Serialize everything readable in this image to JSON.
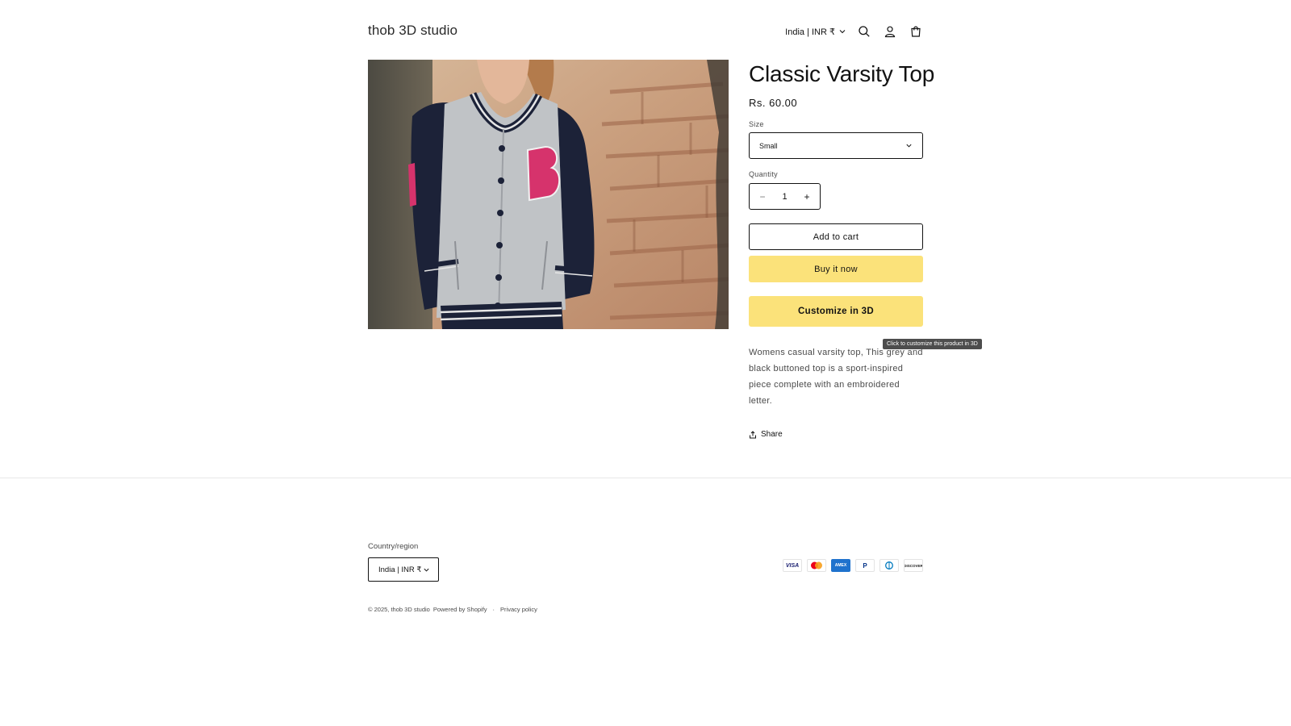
{
  "header": {
    "brand": "thob 3D studio",
    "localization": "India | INR ₹",
    "icons": [
      "search-icon",
      "account-icon",
      "cart-icon"
    ]
  },
  "product": {
    "image_alt": "Woman wearing grey varsity jacket with navy sleeves and pink B patch",
    "title": "Classic Varsity Top",
    "price": "Rs. 60.00",
    "size_label": "Size",
    "size_value": "Small",
    "quantity_label": "Quantity",
    "quantity_value": "1",
    "decrease_label": "−",
    "increase_label": "+",
    "add_to_cart": "Add to cart",
    "buy_now": "Buy it now",
    "customize": "Customize in 3D",
    "customize_tooltip": "Click to customize this product in 3D",
    "description": "Womens casual varsity top, This grey and black buttoned top is a sport-inspired piece complete with an embroidered letter.",
    "share": "Share"
  },
  "footer": {
    "region_label": "Country/region",
    "region_value": "India | INR ₹",
    "payments": [
      {
        "name": "visa",
        "label": "VISA"
      },
      {
        "name": "mastercard",
        "label": ""
      },
      {
        "name": "amex",
        "label": "AMEX"
      },
      {
        "name": "paypal",
        "label": "P"
      },
      {
        "name": "diners",
        "label": ""
      },
      {
        "name": "discover",
        "label": "DISCOVER"
      }
    ],
    "copyright": "© 2025, thob 3D studio",
    "powered": "Powered by Shopify",
    "privacy": "Privacy policy"
  },
  "colors": {
    "accent_button": "#fbe27a",
    "text": "#121212",
    "tooltip_bg": "#4d4d4d"
  }
}
